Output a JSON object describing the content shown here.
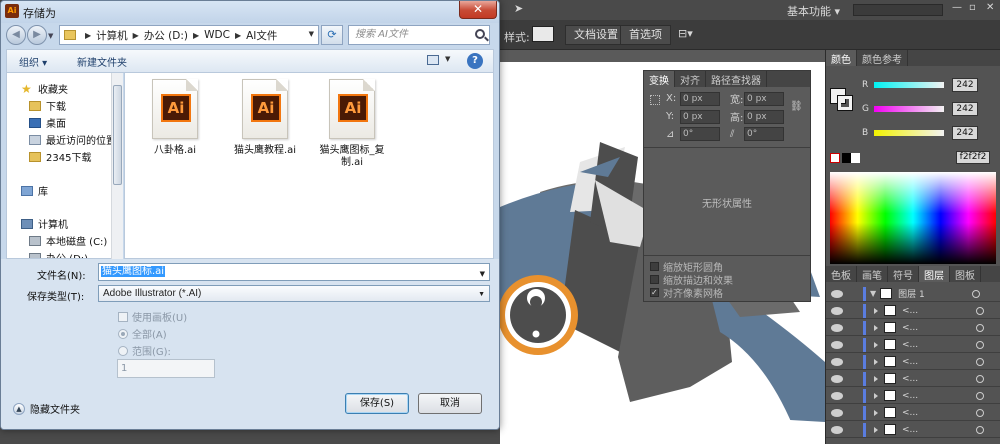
{
  "dialog": {
    "title": "存储为",
    "close_label": "✕",
    "address": {
      "crumbs": [
        "计算机",
        "办公 (D:)",
        "WDC",
        "AI文件"
      ]
    },
    "search_placeholder": "搜索 AI文件",
    "toolbar": {
      "organize": "组织 ▾",
      "new_folder": "新建文件夹"
    },
    "nav_items": [
      "收藏夹",
      "下载",
      "桌面",
      "最近访问的位置",
      "2345下载",
      "库",
      "计算机",
      "本地磁盘 (C:)",
      "办公 (D:)"
    ],
    "files": [
      {
        "name": "八卦格.ai"
      },
      {
        "name": "猫头鹰教程.ai"
      },
      {
        "name": "猫头鹰图标_复制.ai"
      }
    ],
    "form": {
      "filename_label": "文件名(N):",
      "filename_value": "猫头鹰图标.ai",
      "filetype_label": "保存类型(T):",
      "filetype_value": "Adobe Illustrator (*.AI)",
      "use_artboard": "使用画板(U)",
      "all_label": "全部(A)",
      "range_label": "范围(G):",
      "range_value": "1"
    },
    "hide_folders": "隐藏文件夹",
    "save_button": "保存(S)",
    "cancel_button": "取消"
  },
  "illustrator": {
    "workspace": "基本功能 ▾",
    "style_label": "样式:",
    "doc_settings": "文档设置",
    "preferences": "首选项",
    "transform_panel": {
      "tabs": [
        "变换",
        "对齐",
        "路径查找器"
      ],
      "x_label": "X:",
      "x_value": "0 px",
      "y_label": "Y:",
      "y_value": "0 px",
      "w_label": "宽:",
      "w_value": "0 px",
      "h_label": "高:",
      "h_value": "0 px",
      "angle1": "0°",
      "angle2": "0°",
      "no_shape": "无形状属性",
      "checks": [
        "缩放矩形圆角",
        "缩放描边和效果",
        "对齐像素网格"
      ]
    },
    "color_panel": {
      "tabs": [
        "颜色",
        "颜色参考"
      ],
      "r_label": "R",
      "g_label": "G",
      "b_label": "B",
      "r_value": "242",
      "g_value": "242",
      "b_value": "242",
      "hex_value": "f2f2f2"
    },
    "layers_panel": {
      "tabs": [
        "色板",
        "画笔",
        "符号",
        "图层",
        "图板"
      ],
      "layer_name": "图层 1",
      "sublayer_name": "<..."
    }
  },
  "colors": {
    "owl_blue": "#5f7a96",
    "owl_dark": "#4d4d4d",
    "owl_mid": "#6b6b6b",
    "eye_orange": "#e8912e",
    "highlight_blue": "#3399ff"
  }
}
